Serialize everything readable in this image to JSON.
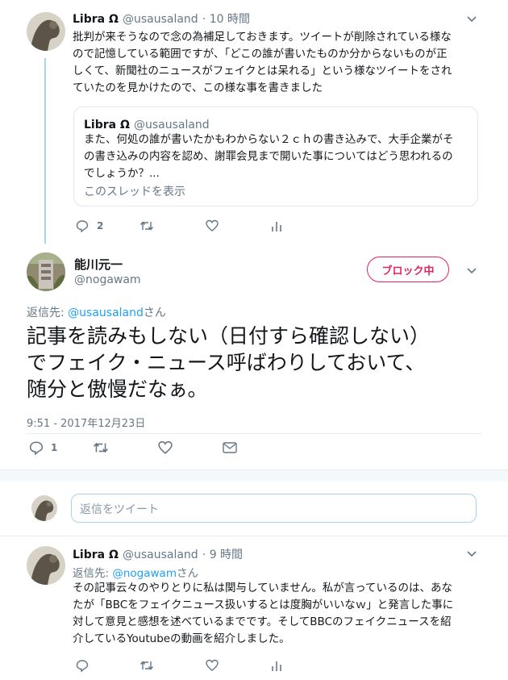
{
  "tweet1": {
    "name": "Libra Ω",
    "handle": "@usausaland",
    "time": "· 10 時間",
    "lines": [
      "批判が来そうなので念の為補足しておきます。ツイートが削除されている様な",
      "ので記憶している範囲ですが、「どこの誰が書いたものか分からないものが正",
      "しくて、新聞社のニュースがフェイクとは呆れる」という様なツイートをされ",
      "ていたのを見かけたので、この様な事を書きました"
    ],
    "quote": {
      "name": "Libra Ω",
      "handle": "@usausaland",
      "lines": [
        "また、何処の誰が書いたかもわからない２ｃｈの書き込みで、大手企業がそ",
        "の書き込みの内容を認め、謝罪会見まで開いた事についてはどう思われるの",
        "でしょうか？..."
      ],
      "show_thread": "このスレッドを表示"
    },
    "reply_count": "2"
  },
  "main_tweet": {
    "name": "能川元一",
    "handle": "@nogawam",
    "block_label": "ブロック中",
    "reply_to_prefix": "返信先: ",
    "reply_to_user": "@usausaland",
    "reply_to_suffix": "さん",
    "lines": [
      "記事を読みもしない（日付すら確認しない）",
      "でフェイク・ニュース呼ばわりしておいて、",
      "随分と傲慢だなぁ。"
    ],
    "timestamp": "9:51 - 2017年12月23日",
    "reply_count": "1"
  },
  "reply_box": {
    "placeholder": "返信をツイート"
  },
  "tweet3": {
    "name": "Libra Ω",
    "handle": "@usausaland",
    "time": "· 9 時間",
    "reply_to_prefix": "返信先: ",
    "reply_to_user": "@nogawam",
    "reply_to_suffix": "さん",
    "lines": [
      "その記事云々のやりとりに私は関与していません。私が言っているのは、あな",
      "たが「BBCをフェイクニュース扱いするとは度胸がいいなｗ」と発言した事に",
      "対して意見と感想を述べているまでです。そしてBBCのフェイクニュースを紹",
      "介しているYoutubeの動画を紹介しました。"
    ]
  },
  "icons": {
    "reply": "reply-icon",
    "retweet": "retweet-icon",
    "like": "heart-icon",
    "analytics": "analytics-icon",
    "message": "direct-message-icon",
    "caret": "chevron-down-icon"
  },
  "colors": {
    "accent": "#1da1f2",
    "block": "#e0245e",
    "secondary_text": "#657786",
    "thread_line": "#a9d3f5"
  }
}
